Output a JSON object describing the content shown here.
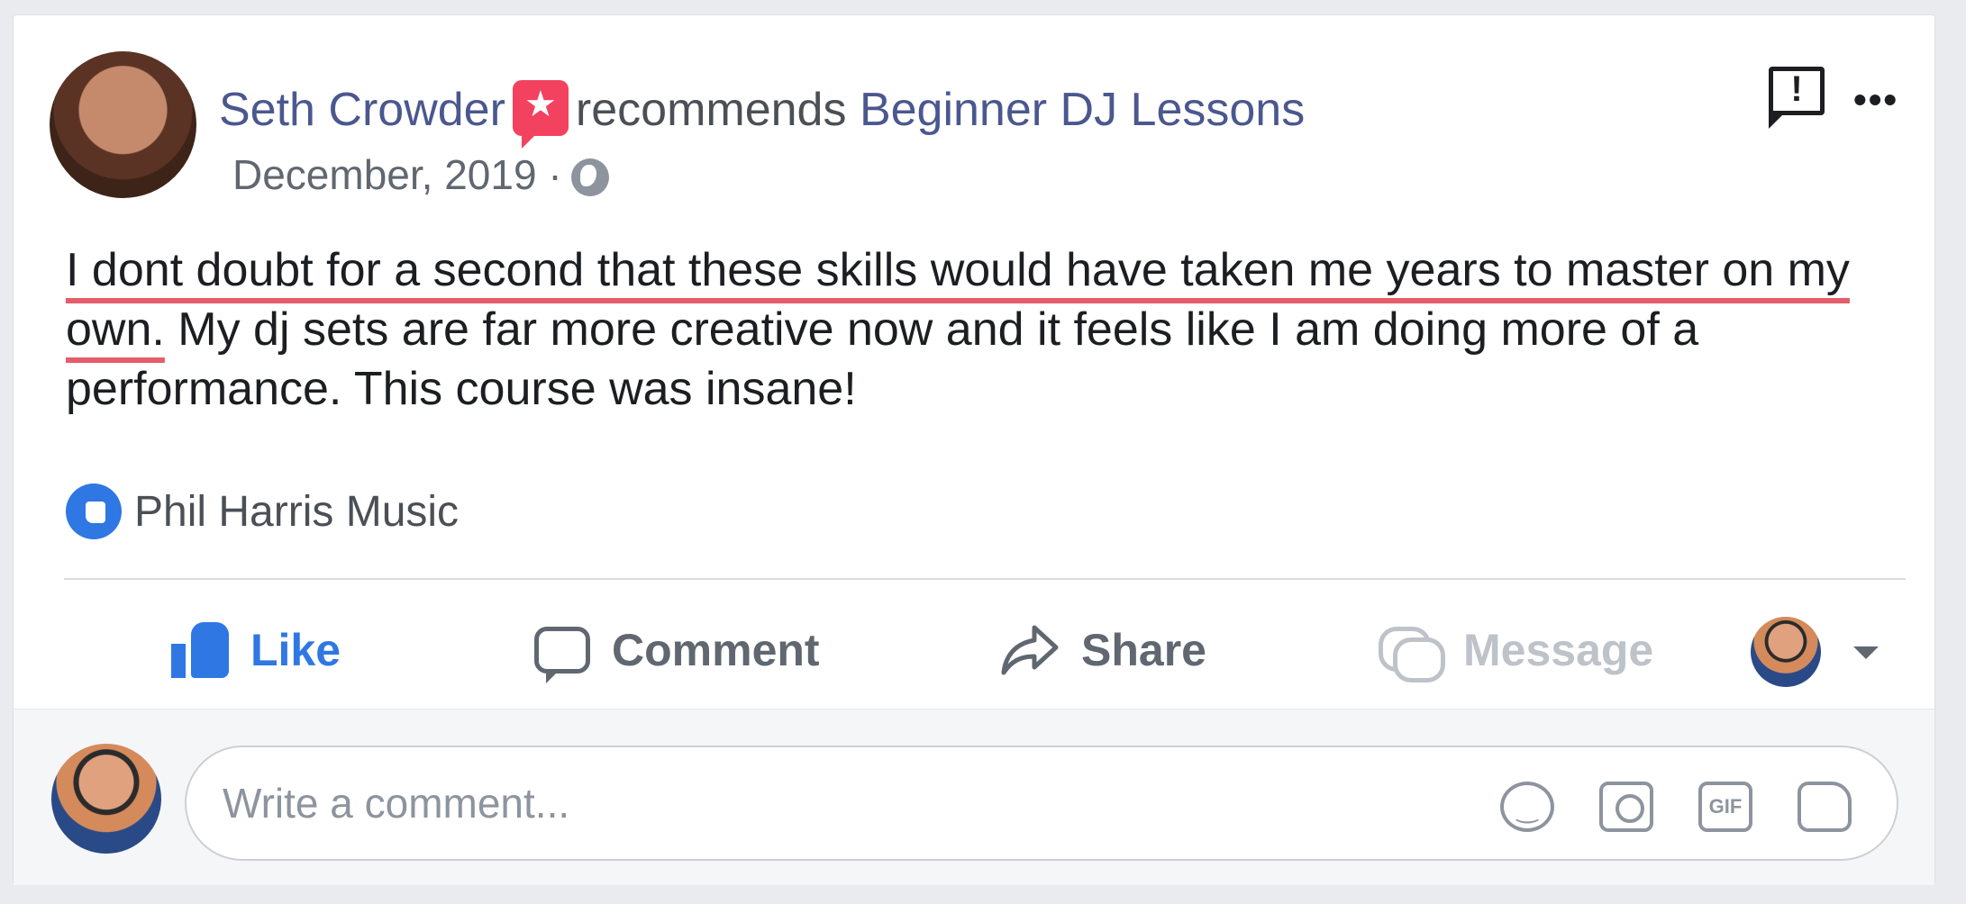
{
  "post": {
    "author": "Seth Crowder",
    "verb": "recommends",
    "page": "Beginner DJ Lessons",
    "date": "December, 2019",
    "separator": "·",
    "text_highlighted": "I dont doubt for a second that these skills would have taken me years to master on my own.",
    "text_rest": " My dj sets are far more creative now and it feels like I am doing more of a performance. This course was insane!",
    "liked_by": "Phil Harris Music",
    "report_symbol": "!",
    "more_symbol": "•••"
  },
  "actions": {
    "like": "Like",
    "comment": "Comment",
    "share": "Share",
    "message": "Message"
  },
  "composer": {
    "placeholder": "Write a comment...",
    "gif_label": "GIF"
  },
  "colors": {
    "link": "#4b578f",
    "like_blue": "#2f77e3",
    "highlight_underline": "#e35d6a",
    "recommend_badge": "#f3425f"
  },
  "icons": [
    "recommend-star-icon",
    "globe-icon",
    "report-icon",
    "more-icon",
    "like-reaction-icon",
    "thumbs-up-icon",
    "comment-icon",
    "share-icon",
    "message-icon",
    "dropdown-caret-icon",
    "emoji-icon",
    "camera-icon",
    "gif-icon",
    "sticker-icon"
  ]
}
